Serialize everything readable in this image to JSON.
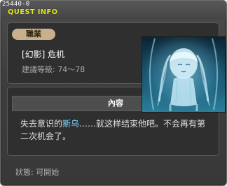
{
  "window": {
    "id_label": "25440-0",
    "title": "QUEST INFO"
  },
  "quest": {
    "job_label": "職業",
    "name": "[幻影] 危机",
    "recommended_level": "建議等級: 74～78"
  },
  "content": {
    "header": "內容",
    "description_before": "失去意识的",
    "description_highlight": "斯乌",
    "description_after": "……就这样结束他吧。不会再有第二次机会了。"
  },
  "footer": {
    "status": "狀態: 可開始"
  },
  "colors": {
    "title": "#e8e81a",
    "highlight_name": "#76d8ff",
    "job_badge": "#c7b08a"
  },
  "portrait": {
    "name": "ghost-girl-portrait"
  }
}
